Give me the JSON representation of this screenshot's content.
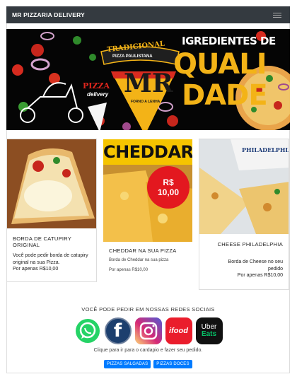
{
  "navbar": {
    "brand": "MR PIZZARIA DELIVERY",
    "toggle_icon": "hamburger-icon"
  },
  "hero": {
    "badge_line1": "TRADICIONAL",
    "badge_line2": "PIZZA PAULISTANA",
    "logo": "MR",
    "logo_sub": "FORNO A LENHA",
    "scooter_line1": "PIZZA",
    "scooter_line2": "delivery",
    "headline_top": "IGREDIENTES DE",
    "headline_1": "QUALI",
    "headline_2": "DADE"
  },
  "cards": [
    {
      "title": "BORDA DE CATUPIRY ORIGINAL",
      "text": "Você pode pedir borda de catupiry original na sua Pizza.",
      "price": "Por apenas R$10,00"
    },
    {
      "banner": "CHEDDAR",
      "badge_price_line1": "R$",
      "badge_price_line2": "10,00",
      "title": "CHEDDAR NA SUA PIZZA",
      "text": "Borda de Cheddar na sua pizza",
      "price": "Por apenas R$10,00"
    },
    {
      "package_label": "PHILADELPHIA",
      "title": "CHEESE PHILADELPHIA",
      "text": "Borda de Cheese no seu pedido",
      "price": "Por apenas R$10,00"
    }
  ],
  "footer": {
    "title": "VOCÊ PODE PEDIR EM NOSSAS REDES SOCIAIS",
    "socials": [
      {
        "name": "whatsapp",
        "color": "#25d366"
      },
      {
        "name": "facebook",
        "color": "#1c3f6e",
        "label": "f"
      },
      {
        "name": "instagram",
        "color": "#c13584"
      },
      {
        "name": "ifood",
        "color": "#ea1d2c",
        "label": "ifood"
      },
      {
        "name": "ubereats",
        "color": "#111111",
        "label1": "Uber",
        "label2": "Eats"
      }
    ],
    "subtitle": "Clique para ir para o cardapio e fazer seu pedido.",
    "buttons": [
      "PIZZAS SALGADAS",
      "PIZZAS DOCES"
    ]
  }
}
